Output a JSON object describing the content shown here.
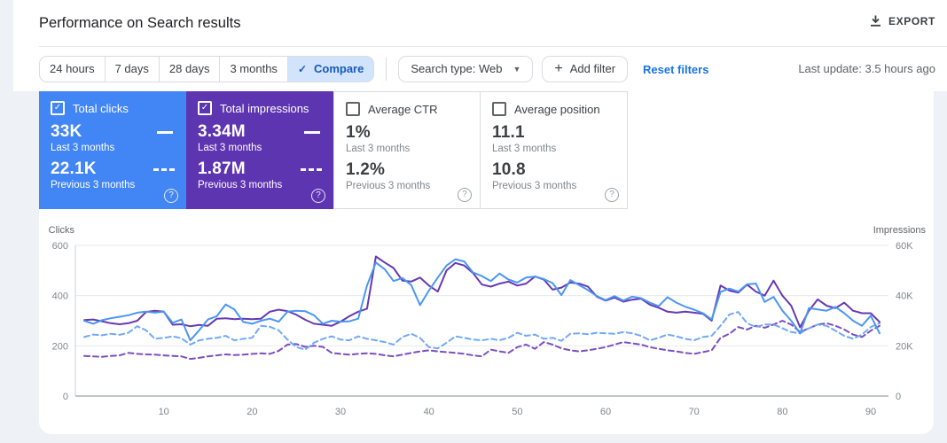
{
  "header": {
    "title": "Performance on Search results",
    "export_label": "EXPORT"
  },
  "filters": {
    "date_chips": [
      {
        "label": "24 hours",
        "selected": false
      },
      {
        "label": "7 days",
        "selected": false
      },
      {
        "label": "28 days",
        "selected": false
      },
      {
        "label": "3 months",
        "selected": false
      },
      {
        "label": "Compare",
        "selected": true
      }
    ],
    "compare_check": "✓",
    "search_type_label": "Search type: Web",
    "add_filter_label": "Add filter",
    "reset_label": "Reset filters",
    "last_update": "Last update: 3.5 hours ago"
  },
  "metrics": [
    {
      "label": "Total clicks",
      "checked": true,
      "accent": "#4285f4",
      "current": "33K",
      "current_caption": "Last 3 months",
      "previous": "22.1K",
      "previous_caption": "Previous 3 months"
    },
    {
      "label": "Total impressions",
      "checked": true,
      "accent": "#5e35b1",
      "current": "3.34M",
      "current_caption": "Last 3 months",
      "previous": "1.87M",
      "previous_caption": "Previous 3 months"
    },
    {
      "label": "Average CTR",
      "checked": false,
      "current": "1%",
      "current_caption": "Last 3 months",
      "previous": "1.2%",
      "previous_caption": "Previous 3 months"
    },
    {
      "label": "Average position",
      "checked": false,
      "current": "11.1",
      "current_caption": "Last 3 months",
      "previous": "10.8",
      "previous_caption": "Previous 3 months"
    }
  ],
  "chart_data": {
    "type": "line",
    "ylabel_left": "Clicks",
    "ylabel_right": "Impressions",
    "yticks_left": [
      0,
      200,
      400,
      600
    ],
    "yticks_right_labels": [
      "0",
      "20K",
      "40K",
      "60K"
    ],
    "ylim_left": [
      0,
      600
    ],
    "ylim_right": [
      0,
      60000
    ],
    "x_ticks": [
      10,
      20,
      30,
      40,
      50,
      60,
      70,
      80,
      90
    ],
    "x_range": [
      1,
      91
    ],
    "grid": "horizontal",
    "legend_position": "none",
    "series": [
      {
        "name": "Impressions - Previous 3 months",
        "axis": "right",
        "units": "K",
        "style": "dashed",
        "color": "#7a4fc0",
        "values": [
          16.0,
          15.8,
          15.6,
          16.0,
          16.2,
          17.2,
          16.8,
          16.6,
          16.5,
          16.2,
          16.0,
          15.8,
          14.8,
          15.2,
          15.8,
          16.2,
          16.6,
          16.3,
          16.5,
          16.8,
          17.0,
          16.8,
          18.0,
          20.5,
          20.7,
          19.6,
          20.0,
          19.6,
          17.2,
          16.8,
          16.5,
          16.8,
          17.0,
          16.8,
          16.2,
          15.8,
          16.5,
          17.2,
          17.8,
          18.2,
          17.8,
          17.5,
          17.2,
          16.8,
          16.2,
          15.8,
          18.5,
          17.8,
          17.2,
          19.5,
          20.5,
          18.8,
          21.5,
          20.5,
          19.0,
          18.2,
          17.8,
          18.2,
          18.8,
          19.5,
          20.5,
          21.5,
          21.0,
          20.5,
          19.5,
          18.8,
          18.2,
          17.8,
          17.2,
          16.8,
          17.5,
          18.2,
          23.2,
          24.8,
          27.5,
          26.5,
          28.0,
          27.2,
          28.5,
          30.0,
          28.5,
          25.5,
          27.0,
          28.5,
          29.0,
          28.0,
          26.5,
          24.5,
          23.5,
          26.0,
          28.0
        ]
      },
      {
        "name": "Clicks - Previous 3 months",
        "axis": "left",
        "units": "clicks",
        "style": "dashed",
        "color": "#71a9f6",
        "values": [
          235,
          245,
          242,
          248,
          244,
          252,
          278,
          262,
          228,
          232,
          238,
          230,
          205,
          222,
          228,
          232,
          240,
          222,
          228,
          232,
          280,
          276,
          262,
          225,
          195,
          185,
          212,
          228,
          238,
          225,
          222,
          238,
          228,
          222,
          215,
          205,
          235,
          248,
          232,
          195,
          190,
          212,
          238,
          232,
          225,
          222,
          228,
          222,
          232,
          252,
          240,
          245,
          228,
          232,
          220,
          248,
          250,
          246,
          252,
          250,
          248,
          255,
          250,
          240,
          222,
          232,
          245,
          238,
          228,
          222,
          235,
          240,
          280,
          325,
          335,
          290,
          275,
          285,
          285,
          270,
          255,
          250,
          270,
          285,
          280,
          260,
          240,
          228,
          245,
          275,
          290
        ]
      },
      {
        "name": "Impressions - Last 3 months",
        "axis": "right",
        "units": "K",
        "style": "solid",
        "color": "#6639b3",
        "values": [
          30.3,
          30.5,
          29.8,
          29.0,
          28.6,
          29.0,
          30.0,
          33.5,
          34.0,
          33.6,
          28.4,
          28.6,
          27.8,
          28.3,
          28.0,
          30.8,
          31.0,
          30.6,
          30.8,
          30.6,
          30.8,
          33.6,
          34.4,
          33.8,
          32.4,
          30.4,
          28.8,
          28.4,
          28.0,
          29.6,
          31.8,
          33.6,
          34.8,
          55.6,
          53.2,
          51.0,
          46.0,
          45.6,
          47.2,
          44.0,
          41.6,
          50.0,
          53.0,
          52.0,
          49.0,
          44.4,
          43.6,
          44.8,
          45.6,
          44.0,
          44.8,
          47.6,
          46.4,
          42.4,
          43.2,
          45.2,
          44.8,
          43.6,
          39.6,
          38.0,
          39.2,
          37.6,
          38.4,
          38.8,
          36.4,
          35.2,
          33.6,
          33.2,
          33.6,
          33.2,
          32.8,
          30.0,
          44.0,
          42.0,
          41.2,
          44.4,
          41.6,
          40.0,
          46.0,
          40.0,
          36.0,
          27.4,
          34.0,
          38.5,
          36.0,
          35.0,
          37.2,
          34.0,
          33.0,
          33.0,
          29.5
        ]
      },
      {
        "name": "Clicks - Last 3 months",
        "axis": "left",
        "units": "clicks",
        "style": "solid",
        "color": "#4b96f3",
        "values": [
          300,
          288,
          302,
          310,
          316,
          322,
          332,
          336,
          332,
          336,
          292,
          305,
          222,
          262,
          305,
          318,
          365,
          345,
          295,
          288,
          300,
          308,
          296,
          336,
          340,
          338,
          322,
          288,
          300,
          296,
          298,
          308,
          440,
          532,
          505,
          458,
          470,
          442,
          362,
          420,
          472,
          520,
          545,
          536,
          492,
          478,
          458,
          488,
          464,
          452,
          472,
          476,
          466,
          450,
          402,
          462,
          442,
          422,
          398,
          382,
          398,
          380,
          396,
          390,
          372,
          358,
          394,
          372,
          356,
          344,
          330,
          305,
          415,
          428,
          416,
          445,
          448,
          375,
          395,
          340,
          300,
          250,
          350,
          345,
          340,
          355,
          330,
          300,
          280,
          320,
          250
        ]
      }
    ]
  }
}
